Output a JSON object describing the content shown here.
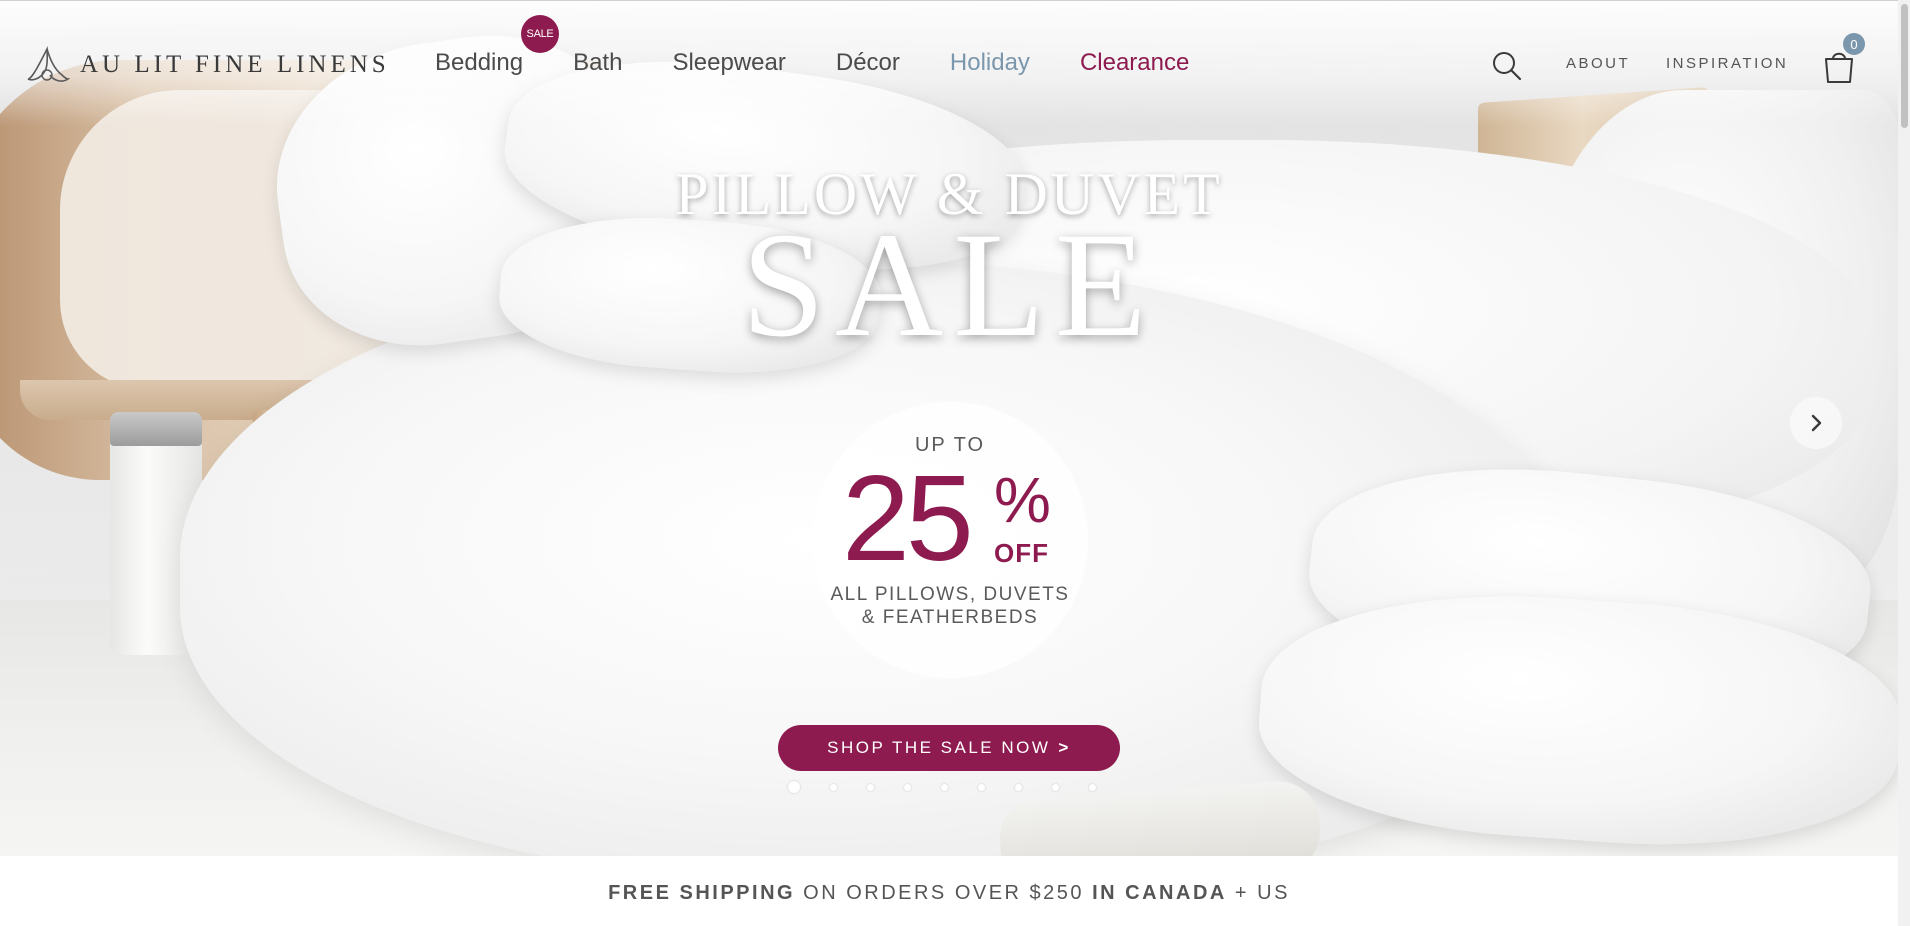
{
  "brand": {
    "name": "AU LIT FINE LINENS"
  },
  "nav": {
    "items": [
      {
        "label": "Bedding",
        "badge": "SALE"
      },
      {
        "label": "Bath"
      },
      {
        "label": "Sleepwear"
      },
      {
        "label": "Décor"
      },
      {
        "label": "Holiday"
      },
      {
        "label": "Clearance"
      }
    ]
  },
  "utility": {
    "about": "ABOUT",
    "inspiration": "INSPIRATION",
    "cart_count": "0"
  },
  "hero": {
    "headline": "PILLOW & DUVET",
    "sale_word": "SALE",
    "promo": {
      "up_to": "UP TO",
      "amount": "25",
      "percent": "%",
      "off": "OFF",
      "line1": "ALL PILLOWS, DUVETS",
      "line2": "& FEATHERBEDS"
    },
    "cta": {
      "label": "SHOP THE SALE NOW",
      "chevron": ">"
    },
    "slides": {
      "count": 9,
      "active": 1
    }
  },
  "shipping": {
    "part1": "FREE SHIPPING",
    "part2": " ON ORDERS OVER $250 ",
    "part3": "IN CANADA",
    "part4": " + US"
  },
  "icons": [
    "logo-mark-icon",
    "search-icon",
    "cart-icon",
    "chevron-right-icon"
  ],
  "colors": {
    "accent": "#8e1b4f",
    "holiday": "#7a97ad",
    "text": "#4b4b4b"
  }
}
